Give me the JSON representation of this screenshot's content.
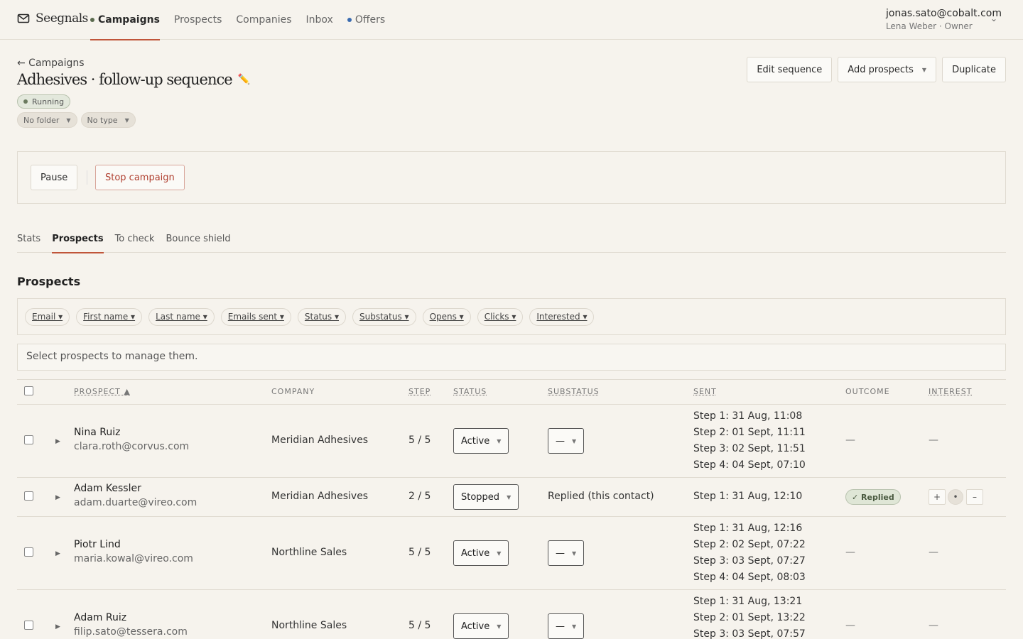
{
  "app": {
    "name": "Seegnals"
  },
  "nav": {
    "items": [
      {
        "label": "Campaigns",
        "dot": "#5b6b4f"
      },
      {
        "label": "Prospects"
      },
      {
        "label": "Companies"
      },
      {
        "label": "Inbox"
      },
      {
        "label": "Offers",
        "dot": "#3a6bb0"
      }
    ]
  },
  "user": {
    "email": "jonas.sato@cobalt.com",
    "sub": "Lena Weber · Owner"
  },
  "header": {
    "back": "← Campaigns",
    "title": "Adhesives · follow-up sequence",
    "status": "Running",
    "folder": "No folder",
    "type": "No type"
  },
  "actions": {
    "edit": "Edit sequence",
    "add": "Add prospects",
    "duplicate": "Duplicate"
  },
  "controls": {
    "pause": "Pause",
    "stop": "Stop campaign"
  },
  "tabs": [
    "Stats",
    "Prospects",
    "To check",
    "Bounce shield"
  ],
  "section_title": "Prospects",
  "filters": [
    "Email ▾",
    "First name ▾",
    "Last name ▾",
    "Emails sent ▾",
    "Status ▾",
    "Substatus ▾",
    "Opens ▾",
    "Clicks ▾",
    "Interested ▾"
  ],
  "hint": "Select prospects to manage them.",
  "columns": {
    "prospect": "PROSPECT ▲",
    "company": "COMPANY",
    "step": "STEP",
    "status": "STATUS",
    "substatus": "SUBSTATUS",
    "sent": "SENT",
    "outcome": "OUTCOME",
    "interest": "INTEREST"
  },
  "rows": [
    {
      "name": "Nina Ruiz",
      "email": "clara.roth@corvus.com",
      "company": "Meridian Adhesives",
      "step": "5 / 5",
      "status": "Active",
      "substatus": "—",
      "sent": [
        "Step 1: 31 Aug, 11:08",
        "Step 2: 01 Sept, 11:11",
        "Step 3: 02 Sept, 11:51",
        "Step 4: 04 Sept, 07:10"
      ],
      "outcome": "—",
      "interest": "—"
    },
    {
      "name": "Adam Kessler",
      "email": "adam.duarte@vireo.com",
      "company": "Meridian Adhesives",
      "step": "2 / 5",
      "status": "Stopped",
      "substatus_text": "Replied (this contact)",
      "sent": [
        "Step 1: 31 Aug, 12:10"
      ],
      "outcome_badge": "✓ Replied",
      "interest_buttons": [
        "+",
        "•",
        "–"
      ]
    },
    {
      "name": "Piotr Lind",
      "email": "maria.kowal@vireo.com",
      "company": "Northline Sales",
      "step": "5 / 5",
      "status": "Active",
      "substatus": "—",
      "sent": [
        "Step 1: 31 Aug, 12:16",
        "Step 2: 02 Sept, 07:22",
        "Step 3: 03 Sept, 07:27",
        "Step 4: 04 Sept, 08:03"
      ],
      "outcome": "—",
      "interest": "—"
    },
    {
      "name": "Adam Ruiz",
      "email": "filip.sato@tessera.com",
      "company": "Northline Sales",
      "step": "5 / 5",
      "status": "Active",
      "substatus": "—",
      "sent": [
        "Step 1: 31 Aug, 13:21",
        "Step 2: 01 Sept, 13:22",
        "Step 3: 03 Sept, 07:57"
      ],
      "outcome": "—",
      "interest": "—"
    }
  ]
}
